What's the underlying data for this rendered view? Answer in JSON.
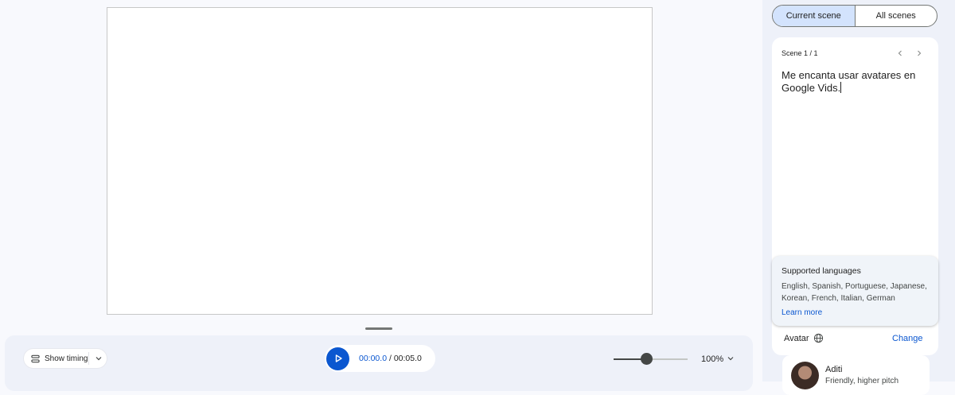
{
  "editor": {
    "timing_label": "Show timing",
    "current_time": "00:00.0",
    "separator": " / ",
    "total_time": "00:05.0",
    "zoom_level": 0.45,
    "zoom_value": "100%"
  },
  "panel": {
    "tabs": [
      {
        "label": "Current scene",
        "active": true
      },
      {
        "label": "All scenes",
        "active": false
      }
    ],
    "scene_label": "Scene 1 / 1",
    "script_text": "Me encanta usar avatares en Google Vids.",
    "tooltip": {
      "title": "Supported languages",
      "body": "English, Spanish, Portuguese, Japanese, Korean, French, Italian, German",
      "link": "Learn more"
    },
    "avatar": {
      "label": "Avatar",
      "change": "Change",
      "name": "Aditi",
      "description": "Friendly, higher pitch"
    }
  },
  "colors": {
    "accent": "#0b57d0",
    "tab_active": "#d3e3fd",
    "panel_bg": "#eef1f9"
  },
  "icons": [
    "timing-icon",
    "chevron-down-icon",
    "play-icon",
    "chevron-left-icon",
    "chevron-right-icon",
    "globe-icon"
  ]
}
